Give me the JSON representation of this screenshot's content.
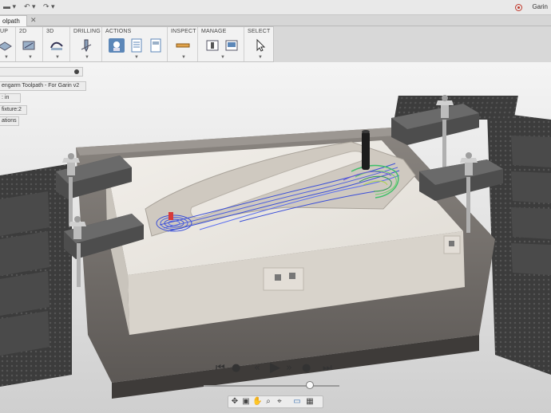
{
  "topbar": {
    "user_name": "Garin",
    "undo_icon": "undo-icon",
    "redo_icon": "redo-icon"
  },
  "tabs": [
    {
      "label": "olpath",
      "active": true
    }
  ],
  "ribbon": {
    "groups": [
      {
        "label": "UP",
        "icon": "setup-icon"
      },
      {
        "label": "2D",
        "icon": "2d-toolpath-icon"
      },
      {
        "label": "3D",
        "icon": "3d-toolpath-icon"
      },
      {
        "label": "DRILLING",
        "icon": "drill-icon"
      },
      {
        "label": "ACTIONS",
        "icons": [
          "simulate-icon",
          "post-process-icon",
          "setup-sheet-icon"
        ]
      },
      {
        "label": "INSPECT",
        "icon": "measure-icon"
      },
      {
        "label": "MANAGE",
        "icons": [
          "tool-library-icon",
          "template-library-icon"
        ]
      },
      {
        "label": "SELECT",
        "icon": "select-cursor-icon"
      }
    ]
  },
  "browser": {
    "rows": [
      {
        "label": ""
      },
      {
        "label": "engarm Toolpath - For Garin v2"
      },
      {
        "label": ": in"
      },
      {
        "label": "fixture:2"
      },
      {
        "label": "ations"
      }
    ]
  },
  "playback": {
    "controls": [
      "skip-to-start-icon",
      "previous-operation-icon",
      "step-back-icon",
      "play-icon",
      "step-forward-icon",
      "next-operation-icon",
      "skip-to-end-icon"
    ],
    "position": 0.75
  },
  "colors": {
    "ribbon_active": "#5c87b8",
    "stock": "#e8e4de",
    "fixture": "#5a5a5a",
    "toolpath_blue": "#3b4fd8",
    "toolpath_green": "#3fbf6a",
    "record_red": "#c0392b"
  }
}
